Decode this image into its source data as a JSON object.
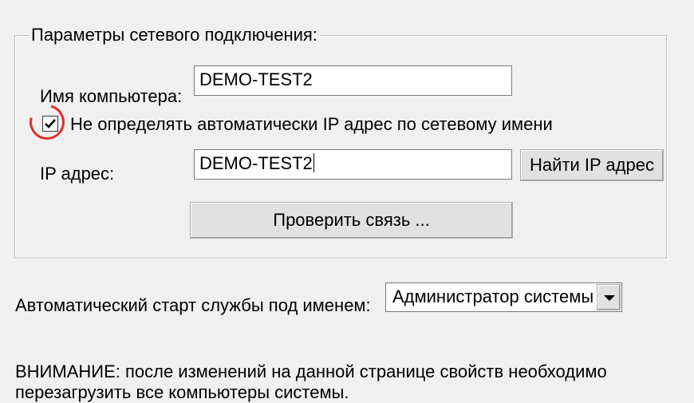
{
  "network_group": {
    "legend": "Параметры сетевого подключения:",
    "computer_name_label": "Имя компьютера:",
    "computer_name_value": "DEMO-TEST2",
    "no_auto_ip_checkbox_label": "Не определять автоматически IP адрес по сетевому имени",
    "no_auto_ip_checked": true,
    "ip_label": "IP адрес:",
    "ip_value": "DEMO-TEST2",
    "find_ip_button": "Найти IP адрес",
    "check_connection_button": "Проверить связь ..."
  },
  "autostart": {
    "label": "Автоматический старт службы под именем:",
    "selected": "Администратор системы"
  },
  "warning": {
    "line1": "ВНИМАНИЕ: после изменений на данной странице свойств необходимо",
    "line2": "перезагрузить все компьютеры системы."
  },
  "colors": {
    "highlight": "#e0312a",
    "background": "#f0f0f0"
  }
}
